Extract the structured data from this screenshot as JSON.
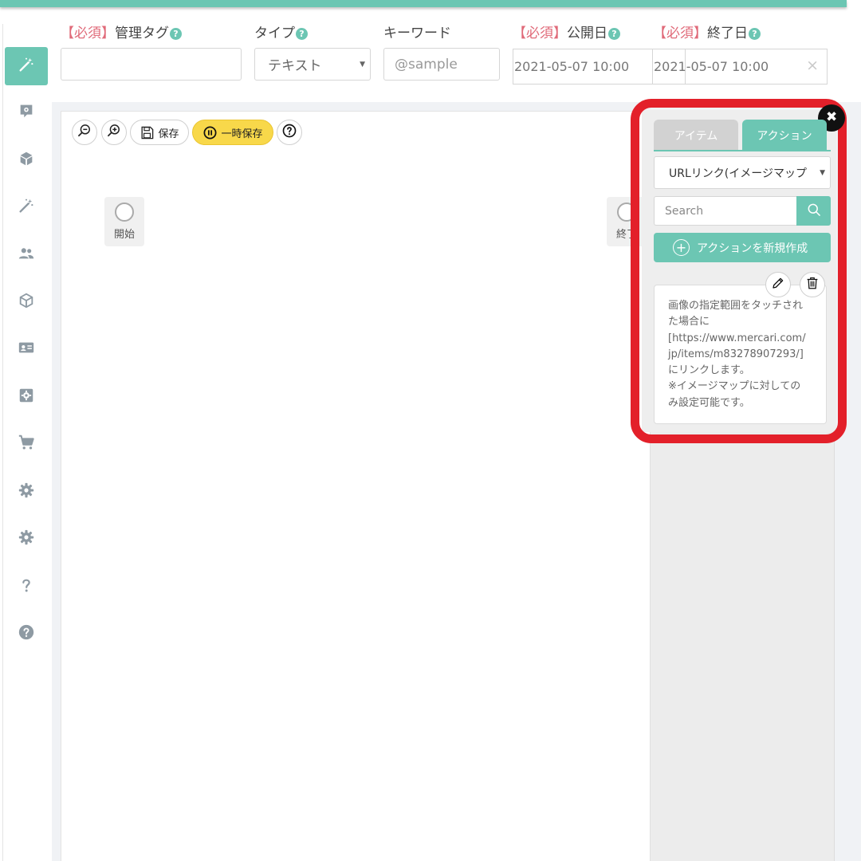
{
  "header": {
    "required_marker": "【必須】",
    "help_mark": "?",
    "labels": {
      "tag": "管理タグ",
      "type": "タイプ",
      "keyword": "キーワード",
      "publish_date": "公開日",
      "end_date": "終了日"
    },
    "tag_value": "",
    "type_value": "テキスト",
    "keyword_placeholder": "@sample",
    "publish_date_value": "2021-05-07 10:00",
    "end_date_value": "2021-05-07 10:00",
    "clear_symbol": "×"
  },
  "sidebar": {
    "items": [
      {
        "icon": "magic-wand-icon",
        "active": true
      },
      {
        "icon": "settings-box-icon",
        "active": false
      },
      {
        "icon": "package-icon",
        "active": false
      },
      {
        "icon": "magic-wand-icon",
        "active": false
      },
      {
        "icon": "users-icon",
        "active": false
      },
      {
        "icon": "cube-icon",
        "active": false
      },
      {
        "icon": "id-card-icon",
        "active": false
      },
      {
        "icon": "settings-box-icon",
        "active": false
      },
      {
        "icon": "cart-icon",
        "active": false
      },
      {
        "icon": "gear-icon",
        "active": false
      },
      {
        "icon": "gear-icon",
        "active": false
      },
      {
        "icon": "question-icon",
        "active": false
      },
      {
        "icon": "help-circle-icon",
        "active": false
      }
    ]
  },
  "toolbar": {
    "save_label": "保存",
    "temp_save_label": "一時保存",
    "help_label": "?"
  },
  "flow": {
    "start_label": "開始",
    "end_label": "終了"
  },
  "panel": {
    "tabs": [
      "アイテム",
      "アクション"
    ],
    "active_tab": "アクション",
    "close_symbol": "✖",
    "action_type": "URLリンク(イメージマップ",
    "search_placeholder": "Search",
    "new_action_label": "アクションを新規作成",
    "new_action_plus": "+",
    "card_lines": [
      "画像の指定範囲をタッチされ",
      "た場合に",
      "[https://www.mercari.com/",
      "jp/items/m83278907293/]",
      "にリンクします。",
      "※イメージマップに対しての",
      "み設定可能です。"
    ]
  },
  "colors": {
    "accent": "#6cc6b3",
    "required": "#e06a79",
    "highlight": "#e3202a",
    "temp_save": "#f8d84a"
  }
}
